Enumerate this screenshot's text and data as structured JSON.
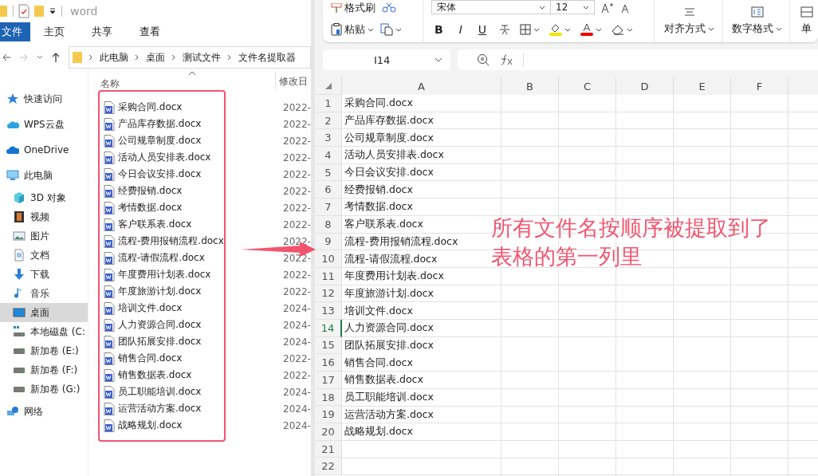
{
  "explorer": {
    "title": "word",
    "tabs": [
      {
        "label": "文件",
        "selected": true
      },
      {
        "label": "主页",
        "selected": false
      },
      {
        "label": "共享",
        "selected": false
      },
      {
        "label": "查看",
        "selected": false
      }
    ],
    "breadcrumbs": [
      "此电脑",
      "桌面",
      "测试文件",
      "文件名提取器"
    ],
    "columns": [
      "名称",
      "修改日"
    ],
    "sidebar": [
      {
        "label": "快速访问",
        "kind": "star",
        "selected": false
      },
      {
        "label": "WPS云盘",
        "kind": "cloud",
        "selected": false
      },
      {
        "label": "OneDrive",
        "kind": "onedrive",
        "selected": false
      },
      {
        "label": "此电脑",
        "kind": "pc",
        "selected": false,
        "children": [
          {
            "label": "3D 对象",
            "kind": "cube",
            "selected": false
          },
          {
            "label": "视频",
            "kind": "video",
            "selected": false
          },
          {
            "label": "图片",
            "kind": "picture",
            "selected": false
          },
          {
            "label": "文档",
            "kind": "document",
            "selected": false
          },
          {
            "label": "下载",
            "kind": "download",
            "selected": false
          },
          {
            "label": "音乐",
            "kind": "music",
            "selected": false
          },
          {
            "label": "桌面",
            "kind": "desktop",
            "selected": true
          },
          {
            "label": "本地磁盘 (C:",
            "kind": "system-disk",
            "selected": false
          },
          {
            "label": "新加卷 (E:)",
            "kind": "disk",
            "selected": false
          },
          {
            "label": "新加卷 (F:)",
            "kind": "disk",
            "selected": false
          },
          {
            "label": "新加卷 (G:)",
            "kind": "disk",
            "selected": false
          }
        ]
      },
      {
        "label": "网络",
        "kind": "network",
        "selected": false
      }
    ],
    "files": [
      {
        "name": "采购合同.docx",
        "modified": "2022-"
      },
      {
        "name": "产品库存数据.docx",
        "modified": "2022-"
      },
      {
        "name": "公司规章制度.docx",
        "modified": "2022-"
      },
      {
        "name": "活动人员安排表.docx",
        "modified": "2022-"
      },
      {
        "name": "今日会议安排.docx",
        "modified": "2022-"
      },
      {
        "name": "经费报销.docx",
        "modified": "2022-"
      },
      {
        "name": "考情数据.docx",
        "modified": "2022-"
      },
      {
        "name": "客户联系表.docx",
        "modified": "2022-"
      },
      {
        "name": "流程-费用报销流程.docx",
        "modified": "2022-"
      },
      {
        "name": "流程-请假流程.docx",
        "modified": "2022-"
      },
      {
        "name": "年度费用计划表.docx",
        "modified": "2022-"
      },
      {
        "name": "年度旅游计划.docx",
        "modified": "2022-"
      },
      {
        "name": "培训文件.docx",
        "modified": "2024-"
      },
      {
        "name": "人力资源合同.docx",
        "modified": "2024-"
      },
      {
        "name": "团队拓展安排.docx",
        "modified": "2024-"
      },
      {
        "name": "销售合同.docx",
        "modified": "2022-"
      },
      {
        "name": "销售数据表.docx",
        "modified": "2022-"
      },
      {
        "name": "员工职能培训.docx",
        "modified": "2024-"
      },
      {
        "name": "运营活动方案.docx",
        "modified": "2024-"
      },
      {
        "name": "战略规划.docx",
        "modified": "2024-"
      }
    ]
  },
  "excel": {
    "ribbon": {
      "format_painter": "格式刷",
      "font": "宋体",
      "size": "12",
      "paste": "粘贴",
      "format_buttons": [
        "B",
        "I",
        "U"
      ],
      "groups": [
        "对齐方式",
        "数字格式",
        "单"
      ]
    },
    "name_box": "I14",
    "columns": [
      "A",
      "B",
      "C",
      "D",
      "E",
      "F"
    ],
    "rows": [
      {
        "number": "1",
        "value": "采购合同.docx",
        "selected": false
      },
      {
        "number": "2",
        "value": "产品库存数据.docx",
        "selected": false
      },
      {
        "number": "3",
        "value": "公司规章制度.docx",
        "selected": false
      },
      {
        "number": "4",
        "value": "活动人员安排表.docx",
        "selected": false
      },
      {
        "number": "5",
        "value": "今日会议安排.docx",
        "selected": false
      },
      {
        "number": "6",
        "value": "经费报销.docx",
        "selected": false
      },
      {
        "number": "7",
        "value": "考情数据.docx",
        "selected": false
      },
      {
        "number": "8",
        "value": "客户联系表.docx",
        "selected": false
      },
      {
        "number": "9",
        "value": "流程-费用报销流程.docx",
        "selected": false
      },
      {
        "number": "10",
        "value": "流程-请假流程.docx",
        "selected": false
      },
      {
        "number": "11",
        "value": "年度费用计划表.docx",
        "selected": false
      },
      {
        "number": "12",
        "value": "年度旅游计划.docx",
        "selected": false
      },
      {
        "number": "13",
        "value": "培训文件.docx",
        "selected": false
      },
      {
        "number": "14",
        "value": "人力资源合同.docx",
        "selected": true
      },
      {
        "number": "15",
        "value": "团队拓展安排.docx",
        "selected": false
      },
      {
        "number": "16",
        "value": "销售合同.docx",
        "selected": false
      },
      {
        "number": "17",
        "value": "销售数据表.docx",
        "selected": false
      },
      {
        "number": "18",
        "value": "员工职能培训.docx",
        "selected": false
      },
      {
        "number": "19",
        "value": "运营活动方案.docx",
        "selected": false
      },
      {
        "number": "20",
        "value": "战略规划.docx",
        "selected": false
      },
      {
        "number": "21",
        "selected": false
      },
      {
        "number": "22",
        "selected": false
      }
    ]
  },
  "annotation": {
    "text": "所有文件名按顺序被提取到了表格的第一列里"
  }
}
